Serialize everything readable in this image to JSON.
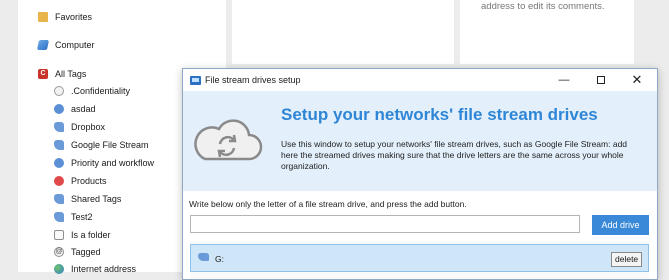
{
  "sidebar": {
    "items": [
      {
        "label": "Favorites",
        "icon": "folder-icon"
      },
      {
        "label": "Computer",
        "icon": "computer-icon"
      },
      {
        "label": "All Tags",
        "icon": "tag-c-icon"
      }
    ],
    "tags": [
      {
        "label": ".Confidentiality",
        "icon": "radio-icon"
      },
      {
        "label": "asdad",
        "icon": "blue-dot-icon"
      },
      {
        "label": "Dropbox",
        "icon": "cloud-drive-icon"
      },
      {
        "label": "Google File Stream",
        "icon": "cloud-drive-icon"
      },
      {
        "label": "Priority and workflow",
        "icon": "blue-dot-icon"
      },
      {
        "label": "Products",
        "icon": "red-dot-icon"
      },
      {
        "label": "Shared Tags",
        "icon": "cloud-drive-icon"
      },
      {
        "label": "Test2",
        "icon": "cloud-drive-icon"
      },
      {
        "label": "Is a folder",
        "icon": "checkbox-icon"
      },
      {
        "label": "Tagged",
        "icon": "at-icon"
      },
      {
        "label": "Internet address",
        "icon": "globe-icon"
      }
    ]
  },
  "right_panel": {
    "text": "address to edit its comments."
  },
  "dialog": {
    "title": "File stream drives setup",
    "minimize": "—",
    "close": "✕",
    "heading": "Setup your networks' file stream drives",
    "description": "Use this window to setup your networks' file stream drives, such as Google File Stream: add here the streamed drives making sure that the drive letters  are the same across your whole organization.",
    "instruction": "Write below only the letter of a file stream drive, and press the add button.",
    "input_value": "",
    "add_button": "Add drive",
    "drives": [
      {
        "label": "G:",
        "delete_label": "delete"
      }
    ]
  },
  "colors": {
    "accent": "#2f86d6",
    "button": "#3a89d8",
    "banner": "#e3f0fb",
    "selected_row": "#cfe6f8"
  }
}
